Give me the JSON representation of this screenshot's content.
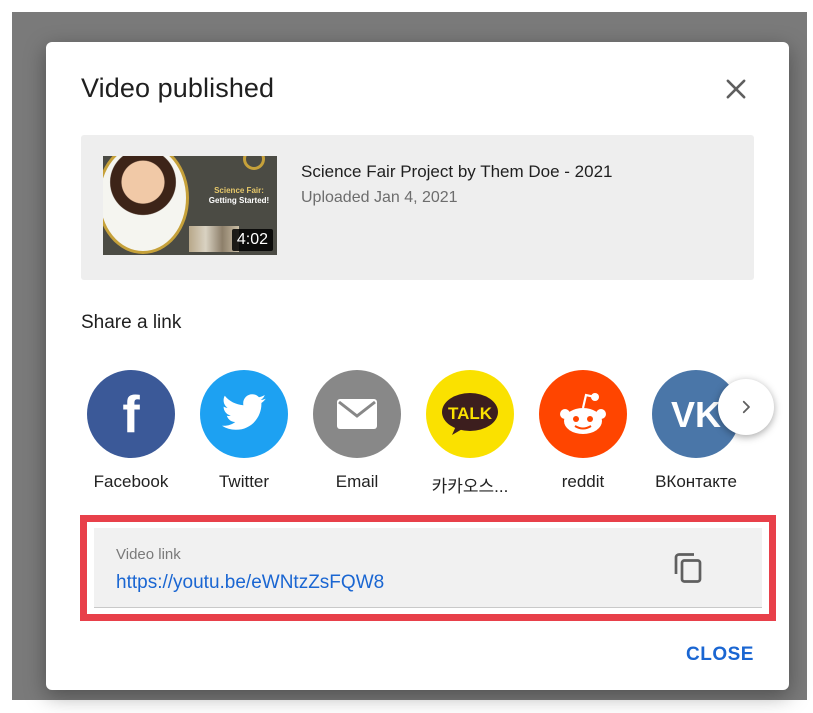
{
  "dialog": {
    "title": "Video published",
    "close_icon": "close-icon"
  },
  "video": {
    "title": "Science Fair Project by Them Doe - 2021",
    "uploaded": "Uploaded Jan 4, 2021",
    "duration": "4:02",
    "thumbnail_line1": "Science Fair:",
    "thumbnail_line2": "Getting Started!"
  },
  "share": {
    "label": "Share a link",
    "items": [
      {
        "label": "Facebook",
        "icon": "facebook-icon",
        "color": "#3b5998"
      },
      {
        "label": "Twitter",
        "icon": "twitter-icon",
        "color": "#1da1f2"
      },
      {
        "label": "Email",
        "icon": "email-icon",
        "color": "#888888"
      },
      {
        "label": "카카오스...",
        "icon": "kakaotalk-icon",
        "color": "#fae100"
      },
      {
        "label": "reddit",
        "icon": "reddit-icon",
        "color": "#ff4500"
      },
      {
        "label": "ВКонтакте",
        "icon": "vk-icon",
        "color": "#4a76a8"
      }
    ],
    "next_icon": "chevron-right-icon"
  },
  "link": {
    "label": "Video link",
    "url": "https://youtu.be/eWNtzZsFQW8",
    "copy_icon": "copy-icon"
  },
  "footer": {
    "close_label": "CLOSE"
  },
  "colors": {
    "accent": "#1a66d2",
    "highlight": "#e8404a"
  }
}
